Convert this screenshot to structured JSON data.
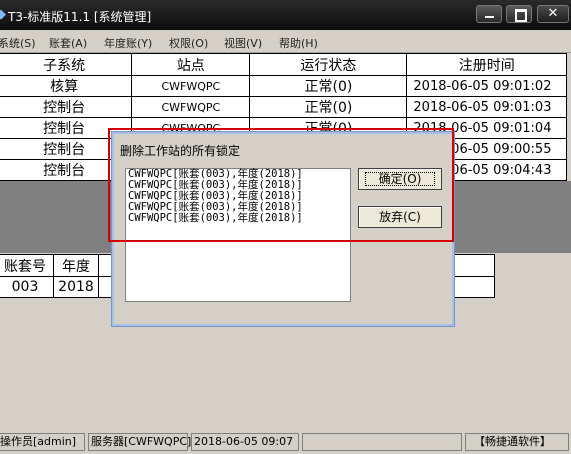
{
  "window": {
    "title": "T3-标准版11.1 [系统管理]",
    "buttons": {
      "minimize": "_",
      "maximize": "□",
      "close": "✕"
    }
  },
  "menu": [
    "系统(S)",
    "账套(A)",
    "年度账(Y)",
    "权限(O)",
    "视图(V)",
    "帮助(H)"
  ],
  "sessions": {
    "columns": [
      "子系统",
      "站点",
      "运行状态",
      "注册时间"
    ],
    "rows": [
      [
        "核算",
        "CWFWQPC",
        "正常(0)",
        "2018-06-05 09:01:02"
      ],
      [
        "控制台",
        "CWFWQPC",
        "正常(0)",
        "2018-06-05 09:01:03"
      ],
      [
        "控制台",
        "CWFWQPC",
        "正常(0)",
        "2018-06-05 09:01:04"
      ],
      [
        "控制台",
        "",
        "",
        "2018-06-05 09:00:55"
      ],
      [
        "控制台",
        "",
        "",
        "2018-06-05 09:04:43"
      ]
    ]
  },
  "accounts": {
    "columns": [
      "账套号",
      "年度"
    ],
    "rows": [
      [
        "003",
        "2018"
      ]
    ]
  },
  "dialog": {
    "title": "删除工作站的所有锁定",
    "locks": [
      "CWFWQPC[账套(003),年度(2018)]",
      "CWFWQPC[账套(003),年度(2018)]",
      "CWFWQPC[账套(003),年度(2018)]",
      "CWFWQPC[账套(003),年度(2018)]",
      "CWFWQPC[账套(003),年度(2018)]"
    ],
    "ok_label": "确定(O)",
    "cancel_label": "放弃(C)"
  },
  "status": {
    "operator": "操作员[admin]",
    "server": "服务器[CWFWQPC]",
    "datetime": "2018-06-05 09:07",
    "brand": "【畅捷通软件】"
  },
  "colors": {
    "highlight": "#d40000",
    "titlebar": "#111111"
  }
}
